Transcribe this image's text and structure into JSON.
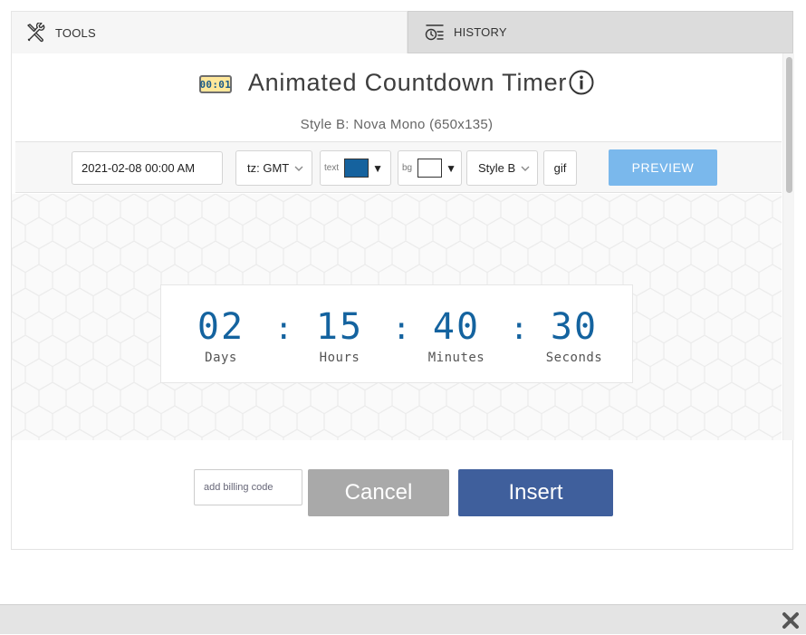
{
  "tabs": {
    "tools": "TOOLS",
    "history": "HISTORY"
  },
  "widget": {
    "badge": "00:01",
    "title": "Animated Countdown Timer",
    "subtitle": "Style B: Nova Mono (650x135)"
  },
  "toolbar": {
    "date_value": "2021-02-08 00:00 AM",
    "tz_label": "tz: GMT",
    "text_label": "text",
    "text_color": "#15629e",
    "bg_label": "bg",
    "bg_color": "#ffffff",
    "triangle": "▼",
    "style_label": "Style B",
    "gif_label": "gif",
    "preview_label": "PREVIEW"
  },
  "timer": {
    "days": "02",
    "hours": "15",
    "minutes": "40",
    "seconds": "30",
    "days_label": "Days",
    "hours_label": "Hours",
    "minutes_label": "Minutes",
    "seconds_label": "Seconds",
    "separator": ":"
  },
  "footer": {
    "billing_placeholder": "add billing code",
    "cancel_label": "Cancel",
    "insert_label": "Insert"
  },
  "colors": {
    "accent_blue": "#7ab8ec",
    "insert_blue": "#3f5f9c",
    "cancel_gray": "#a9a9a9",
    "digit_blue": "#14639f"
  }
}
